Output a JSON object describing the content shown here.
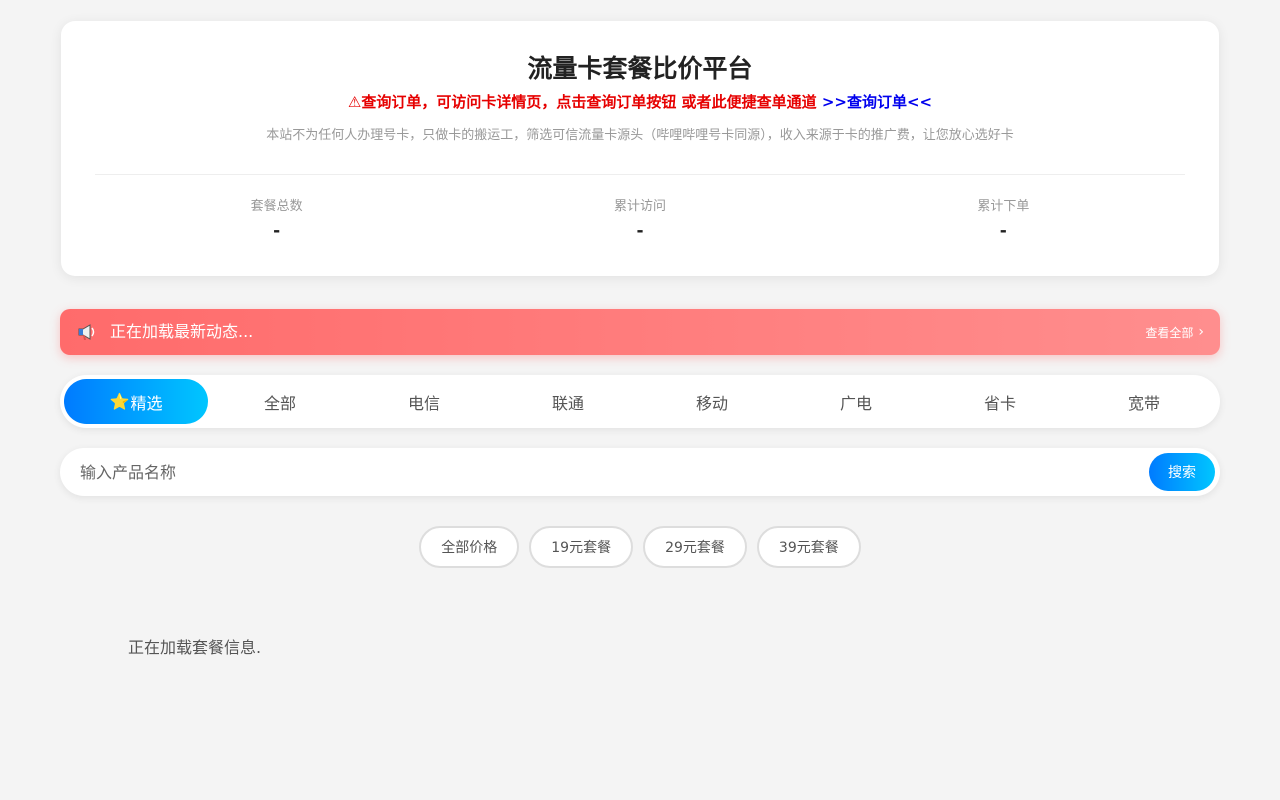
{
  "header": {
    "title": "流量卡套餐比价平台",
    "notice_warning": "⚠查询订单，可访问卡详情页，点击查询订单按钮 或者此便捷查单通道",
    "notice_link": ">>查询订单<<",
    "subtitle": "本站不为任何人办理号卡，只做卡的搬运工，筛选可信流量卡源头（哔哩哔哩号卡同源），收入来源于卡的推广费，让您放心选好卡",
    "stats": [
      {
        "label": "套餐总数",
        "value": "-"
      },
      {
        "label": "累计访问",
        "value": "-"
      },
      {
        "label": "累计下单",
        "value": "-"
      }
    ]
  },
  "news": {
    "icon": "megaphone-icon",
    "text": "正在加载最新动态...",
    "more_label": "查看全部",
    "more_chevron": "›"
  },
  "tabs": {
    "active_index": 0,
    "featured_star": "⭐",
    "items": [
      {
        "label": "精选"
      },
      {
        "label": "全部"
      },
      {
        "label": "电信"
      },
      {
        "label": "联通"
      },
      {
        "label": "移动"
      },
      {
        "label": "广电"
      },
      {
        "label": "省卡"
      },
      {
        "label": "宽带"
      }
    ]
  },
  "search": {
    "placeholder": "输入产品名称",
    "value": "",
    "button_label": "搜索"
  },
  "price_filters": [
    {
      "label": "全部价格"
    },
    {
      "label": "19元套餐"
    },
    {
      "label": "29元套餐"
    },
    {
      "label": "39元套餐"
    }
  ],
  "loading_text": "正在加载套餐信息.",
  "colors": {
    "page_bg": "#f4f4f4",
    "accent_blue": "#007bff",
    "accent_cyan": "#00c6ff",
    "news_red": "#ff6b6b",
    "warning_red": "#e60000",
    "link_blue": "#0000ee"
  }
}
